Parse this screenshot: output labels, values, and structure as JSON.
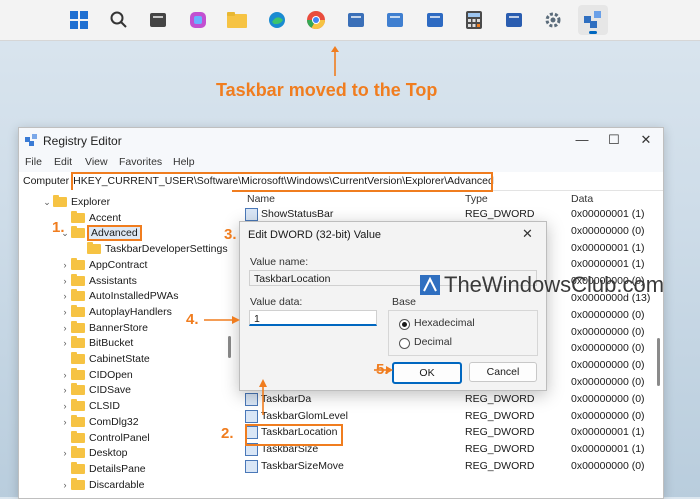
{
  "taskbar": {
    "icons": [
      "windows-start-icon",
      "search-icon",
      "task-view-icon",
      "copilot-icon",
      "file-explorer-icon",
      "edge-icon",
      "chrome-icon",
      "snipping-tool-icon",
      "app-icon",
      "document-icon",
      "calculator-icon",
      "app-icon-blue",
      "settings-icon",
      "registry-editor-icon"
    ]
  },
  "annotation": {
    "caption": "Taskbar moved to the Top",
    "steps": [
      "1.",
      "2.",
      "3.",
      "4.",
      "5."
    ]
  },
  "watermark": "TheWindowsClub.com",
  "regedit": {
    "title": "Registry Editor",
    "window_controls": [
      "—",
      "☐",
      "✕"
    ],
    "menu": [
      "File",
      "Edit",
      "View",
      "Favorites",
      "Help"
    ],
    "address_prefix": "Computer",
    "address_path": "HKEY_CURRENT_USER\\Software\\Microsoft\\Windows\\CurrentVersion\\Explorer\\Advanced",
    "tree": [
      {
        "label": "Explorer",
        "chevron": "⌄"
      },
      {
        "label": "Accent",
        "chevron": ""
      },
      {
        "label": "Advanced",
        "chevron": "⌄"
      },
      {
        "label": "TaskbarDeveloperSettings",
        "chevron": ""
      },
      {
        "label": "AppContract",
        "chevron": "›"
      },
      {
        "label": "Assistants",
        "chevron": "›"
      },
      {
        "label": "AutoInstalledPWAs",
        "chevron": "›"
      },
      {
        "label": "AutoplayHandlers",
        "chevron": "›"
      },
      {
        "label": "BannerStore",
        "chevron": "›"
      },
      {
        "label": "BitBucket",
        "chevron": "›"
      },
      {
        "label": "CabinetState",
        "chevron": ""
      },
      {
        "label": "CIDOpen",
        "chevron": "›"
      },
      {
        "label": "CIDSave",
        "chevron": "›"
      },
      {
        "label": "CLSID",
        "chevron": "›"
      },
      {
        "label": "ComDlg32",
        "chevron": "›"
      },
      {
        "label": "ControlPanel",
        "chevron": ""
      },
      {
        "label": "Desktop",
        "chevron": "›"
      },
      {
        "label": "DetailsPane",
        "chevron": ""
      },
      {
        "label": "Discardable",
        "chevron": "›"
      }
    ],
    "columns": [
      "Name",
      "Type",
      "Data"
    ],
    "rows": [
      {
        "name": "ShowStatusBar",
        "type": "REG_DWORD",
        "data": "0x00000001 (1)"
      },
      {
        "name": "",
        "type": "",
        "data": "0x00000000 (0)"
      },
      {
        "name": "",
        "type": "",
        "data": "0x00000001 (1)"
      },
      {
        "name": "",
        "type": "",
        "data": "0x00000001 (1)"
      },
      {
        "name": "",
        "type": "",
        "data": "0x00000000 (0)"
      },
      {
        "name": "",
        "type": "",
        "data": "0x0000000d (13)"
      },
      {
        "name": "",
        "type": "",
        "data": "0x00000000 (0)"
      },
      {
        "name": "",
        "type": "",
        "data": "0x00000000 (0)"
      },
      {
        "name": "",
        "type": "",
        "data": "0x00000000 (0)"
      },
      {
        "name": "",
        "type": "",
        "data": "0x00000000 (0)"
      },
      {
        "name": "",
        "type": "",
        "data": "0x00000000 (0)"
      },
      {
        "name": "TaskbarDa",
        "type": "REG_DWORD",
        "data": "0x00000000 (0)"
      },
      {
        "name": "TaskbarGlomLevel",
        "type": "REG_DWORD",
        "data": "0x00000000 (0)"
      },
      {
        "name": "TaskbarLocation",
        "type": "REG_DWORD",
        "data": "0x00000001 (1)"
      },
      {
        "name": "TaskbarSize",
        "type": "REG_DWORD",
        "data": "0x00000001 (1)"
      },
      {
        "name": "TaskbarSizeMove",
        "type": "REG_DWORD",
        "data": "0x00000000 (0)"
      }
    ]
  },
  "dialog": {
    "title": "Edit DWORD (32-bit) Value",
    "value_name_label": "Value name:",
    "value_name": "TaskbarLocation",
    "value_data_label": "Value data:",
    "value_data": "1",
    "base_label": "Base",
    "hex_label": "Hexadecimal",
    "dec_label": "Decimal",
    "base_selected": "Hexadecimal",
    "ok_label": "OK",
    "cancel_label": "Cancel"
  },
  "colors": {
    "annotation": "#f07d1f",
    "accent": "#0067c0"
  }
}
